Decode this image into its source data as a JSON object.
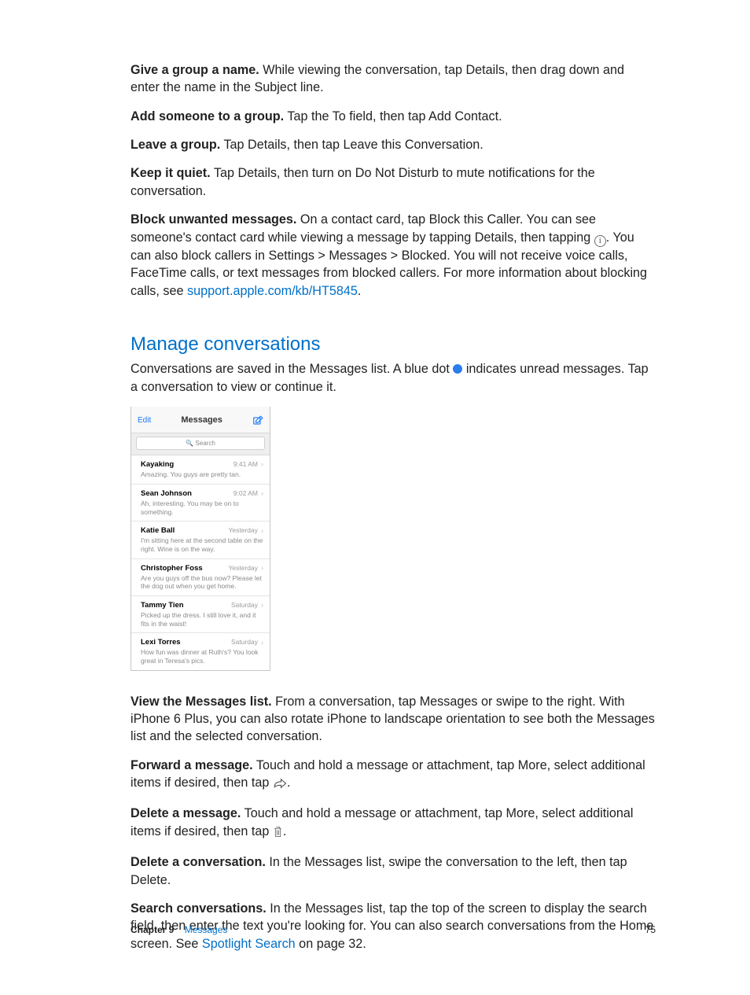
{
  "paragraphs": {
    "p1_bold": "Give a group a name.",
    "p1_text": " While viewing the conversation, tap Details, then drag down and enter the name in the Subject line.",
    "p2_bold": "Add someone to a group.",
    "p2_text": " Tap the To field, then tap Add Contact.",
    "p3_bold": "Leave a group.",
    "p3_text": " Tap Details, then tap Leave this Conversation.",
    "p4_bold": "Keep it quiet.",
    "p4_text": " Tap Details, then turn on Do Not Disturb to mute notifications for the conversation.",
    "p5_bold": "Block unwanted messages.",
    "p5_text_a": " On a contact card, tap Block this Caller. You can see someone's contact card while viewing a message by tapping Details, then tapping ",
    "p5_text_b": ". You can also block callers in Settings > Messages > Blocked. You will not receive voice calls, FaceTime calls, or text messages from blocked callers. For more information about blocking calls, see ",
    "p5_link": "support.apple.com/kb/HT5845",
    "p5_period": "."
  },
  "section_title": "Manage conversations",
  "section_intro_a": "Conversations are saved in the Messages list. A blue dot ",
  "section_intro_b": " indicates unread messages. Tap a conversation to view or continue it.",
  "phone": {
    "edit": "Edit",
    "title": "Messages",
    "search_placeholder": "Search",
    "conversations": [
      {
        "name": "Kayaking",
        "time": "9:41 AM",
        "preview": "Amazing. You guys are pretty tan."
      },
      {
        "name": "Sean Johnson",
        "time": "9:02 AM",
        "preview": "Ah, interesting. You may be on to something."
      },
      {
        "name": "Katie Ball",
        "time": "Yesterday",
        "preview": "I'm sitting here at the second table on the right. Wine is on the way."
      },
      {
        "name": "Christopher Foss",
        "time": "Yesterday",
        "preview": "Are you guys off the bus now? Please let the dog out when you get home."
      },
      {
        "name": "Tammy Tien",
        "time": "Saturday",
        "preview": "Picked up the dress. I still love it, and it fits in the waist!"
      },
      {
        "name": "Lexi Torres",
        "time": "Saturday",
        "preview": "How fun was dinner at Ruth's? You look great in Teresa's pics."
      }
    ]
  },
  "body2": {
    "p6_bold": "View the Messages list.",
    "p6_text": " From a conversation, tap Messages or swipe to the right. With iPhone 6 Plus, you can also rotate iPhone to landscape orientation to see both the Messages list and the selected conversation.",
    "p7_bold": "Forward a message.",
    "p7_text_a": " Touch and hold a message or attachment, tap More, select additional items if desired, then tap ",
    "p7_text_b": ".",
    "p8_bold": "Delete a message.",
    "p8_text_a": " Touch and hold a message or attachment, tap More, select additional items if desired, then tap ",
    "p8_text_b": ".",
    "p9_bold": "Delete a conversation.",
    "p9_text": " In the Messages list, swipe the conversation to the left, then tap Delete.",
    "p10_bold": "Search conversations.",
    "p10_text_a": " In the Messages list, tap the top of the screen to display the search field, then enter the text you're looking for. You can also search conversations from the Home screen. See ",
    "p10_link": "Spotlight Search",
    "p10_text_b": " on page 32."
  },
  "footer": {
    "chapter_label": "Chapter  9",
    "chapter_name": "Messages",
    "page": "75"
  }
}
